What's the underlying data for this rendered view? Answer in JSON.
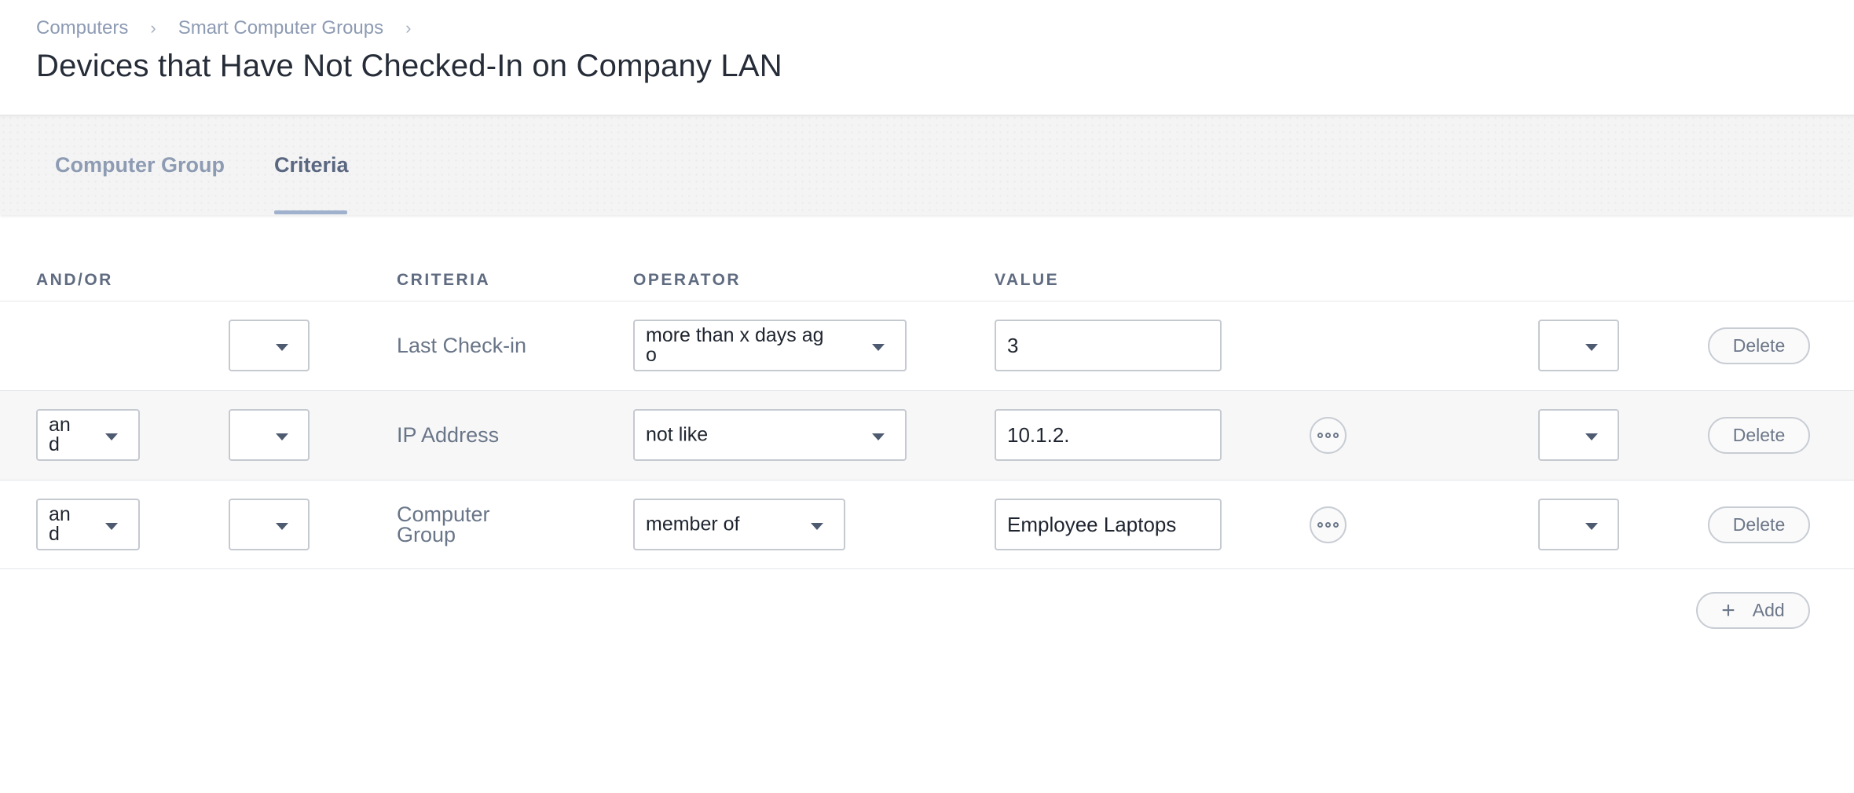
{
  "breadcrumb": {
    "items": [
      "Computers",
      "Smart Computer Groups"
    ],
    "separator": "›"
  },
  "page": {
    "title": "Devices that Have Not Checked-In on Company LAN"
  },
  "tabs": [
    {
      "label": "Computer Group",
      "active": false
    },
    {
      "label": "Criteria",
      "active": true
    }
  ],
  "table": {
    "headers": {
      "and_or": "AND/OR",
      "criteria": "CRITERIA",
      "operator": "OPERATOR",
      "value": "VALUE"
    },
    "rows": [
      {
        "and_or": "",
        "open_paren": "",
        "criteria": "Last Check-in",
        "operator": "more than x days ag\no",
        "value": "3",
        "close_paren": "",
        "delete_label": "Delete"
      },
      {
        "and_or": "an\nd",
        "open_paren": "",
        "criteria": "IP Address",
        "operator": "not like",
        "value": "10.1.2.",
        "close_paren": "",
        "delete_label": "Delete"
      },
      {
        "and_or": "an\nd",
        "open_paren": "",
        "criteria": "Computer\nGroup",
        "operator": "member of",
        "value": "Employee Laptops",
        "close_paren": "",
        "delete_label": "Delete"
      }
    ],
    "add_label": "Add"
  },
  "icons": {
    "dropdown": "chevron-down-icon",
    "more": "more-options-icon",
    "add": "plus-icon"
  },
  "colors": {
    "accent_underline": "#9fb1cc",
    "muted_text": "#8d9bb3",
    "title_text": "#262d38"
  }
}
